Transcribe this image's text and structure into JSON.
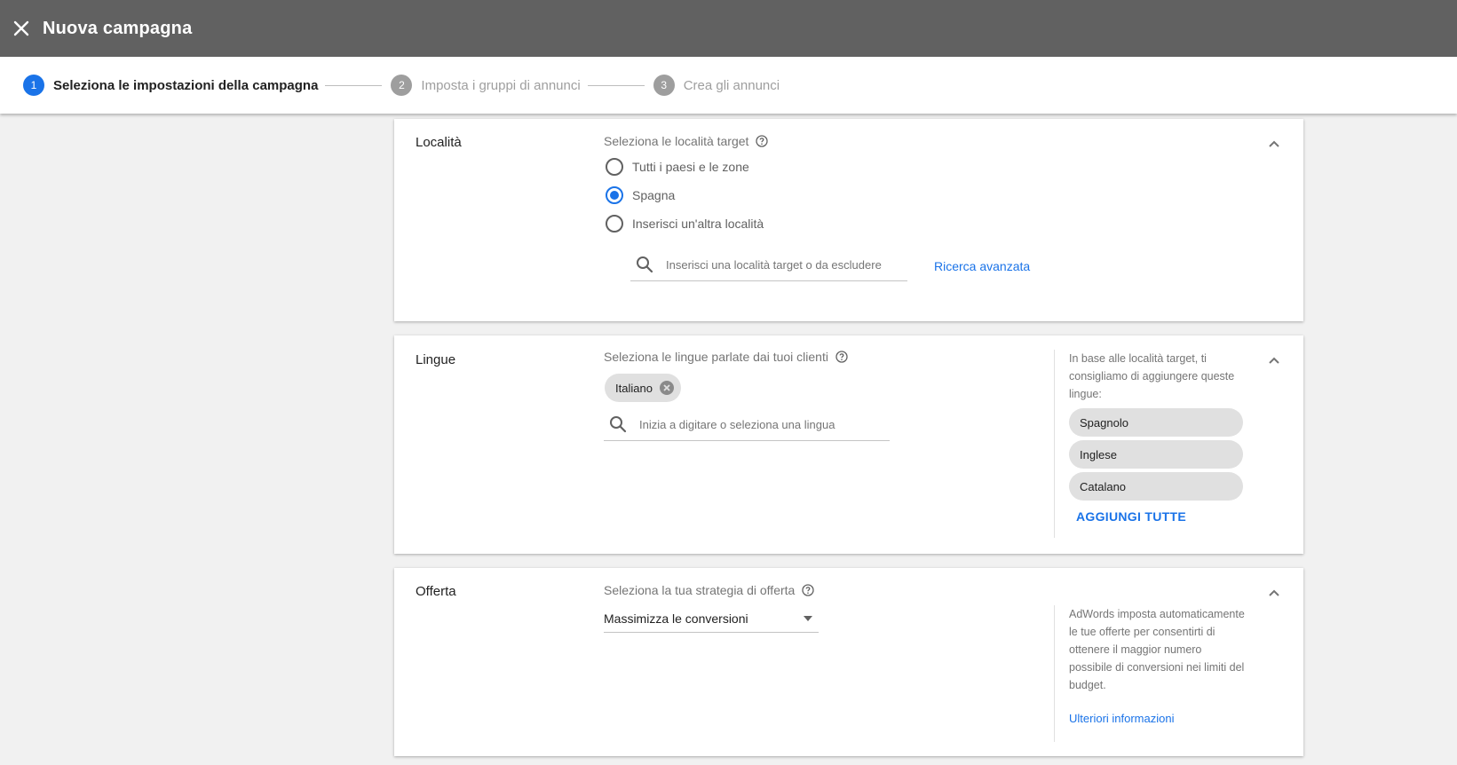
{
  "header": {
    "title": "Nuova campagna"
  },
  "stepper": {
    "steps": [
      {
        "number": "1",
        "label": "Seleziona le impostazioni della campagna",
        "state": "active"
      },
      {
        "number": "2",
        "label": "Imposta i gruppi di annunci",
        "state": "inactive"
      },
      {
        "number": "3",
        "label": "Crea gli annunci",
        "state": "inactive"
      }
    ]
  },
  "locations": {
    "title": "Località",
    "label": "Seleziona le località target",
    "options": [
      {
        "label": "Tutti i paesi e le zone",
        "checked": false
      },
      {
        "label": "Spagna",
        "checked": true
      },
      {
        "label": "Inserisci un'altra località",
        "checked": false
      }
    ],
    "search_placeholder": "Inserisci una località target o da escludere",
    "advanced_search": "Ricerca avanzata"
  },
  "languages": {
    "title": "Lingue",
    "label": "Seleziona le lingue parlate dai tuoi clienti",
    "selected_chip": "Italiano",
    "search_placeholder": "Inizia a digitare o seleziona una lingua",
    "suggestion_text": "In base alle località target, ti consigliamo di aggiungere queste lingue:",
    "suggestions": [
      "Spagnolo",
      "Inglese",
      "Catalano"
    ],
    "add_all": "AGGIUNGI TUTTE"
  },
  "bidding": {
    "title": "Offerta",
    "label": "Seleziona la tua strategia di offerta",
    "selected": "Massimizza le conversioni",
    "info_text": "AdWords imposta automaticamente le tue offerte per consentirti di ottenere il maggior numero possibile di conversioni nei limiti del budget.",
    "more_info": "Ulteriori informazioni"
  },
  "colors": {
    "accent": "#1a73e8",
    "header_bg": "#616161",
    "page_bg": "#f1f1f1"
  }
}
